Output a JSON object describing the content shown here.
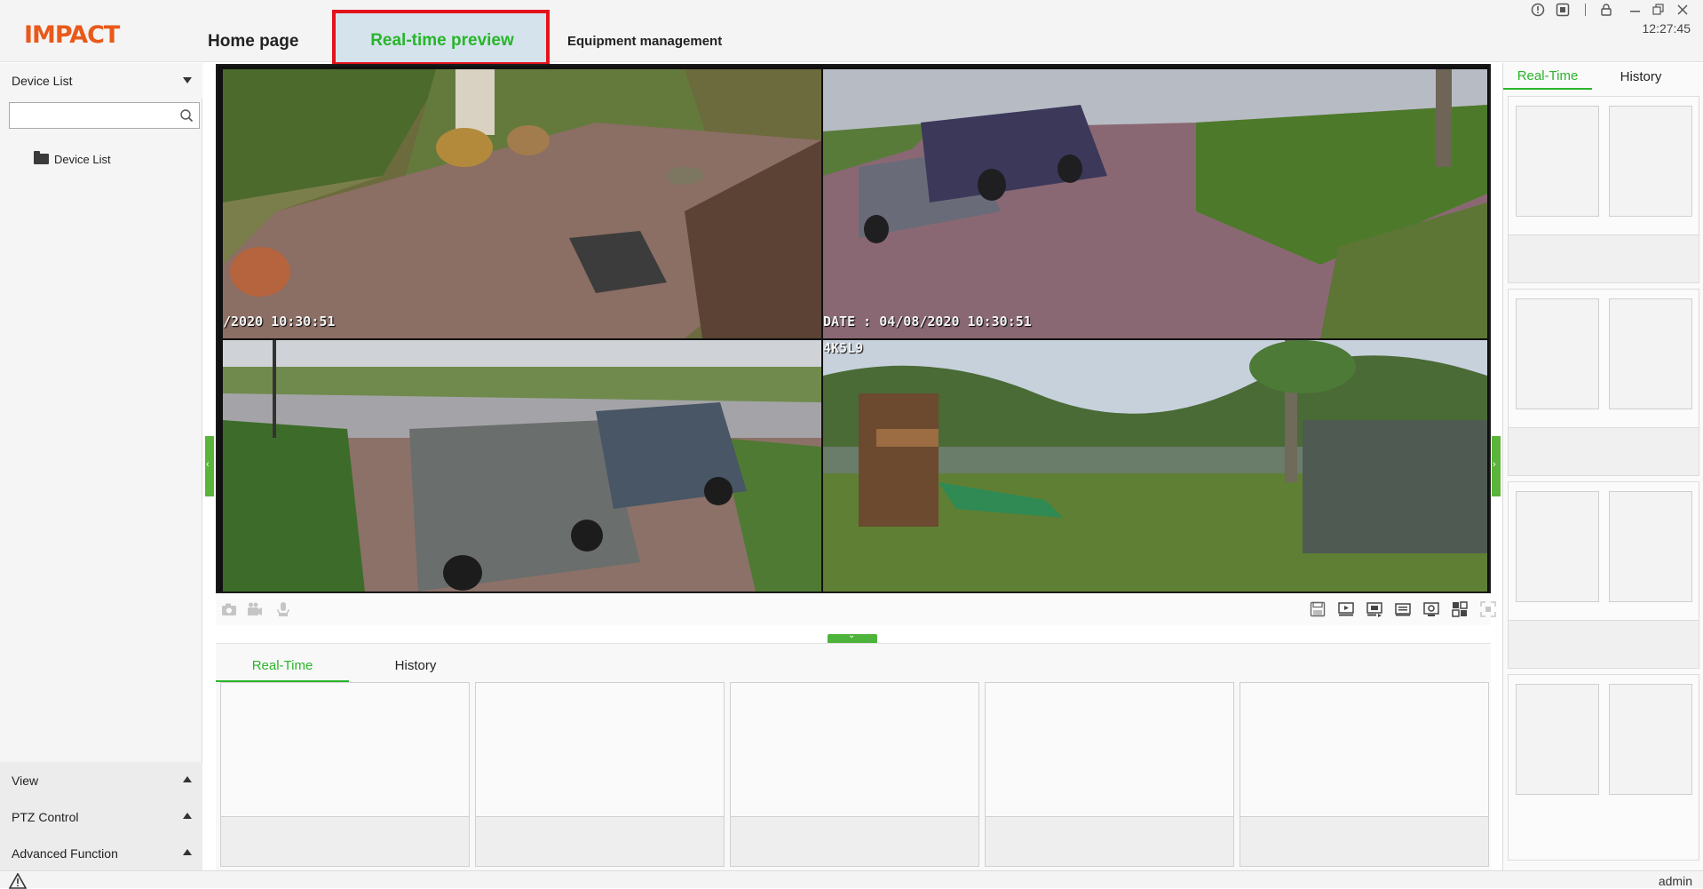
{
  "app": {
    "logo": "IMPACT",
    "clock": "12:27:45",
    "user": "admin"
  },
  "nav": {
    "home": "Home page",
    "realtime": "Real-time preview",
    "equipment": "Equipment management"
  },
  "window_icons": [
    "info-icon",
    "record-icon",
    "lock-icon",
    "minimize-icon",
    "restore-icon",
    "close-icon"
  ],
  "sidebar": {
    "device_list_header": "Device List",
    "search": {
      "value": "",
      "placeholder": ""
    },
    "tree": [
      {
        "label": "Device List",
        "icon": "folder-icon"
      }
    ],
    "sections": [
      {
        "label": "View"
      },
      {
        "label": "PTZ Control"
      },
      {
        "label": "Advanced Function"
      }
    ]
  },
  "video": {
    "timestamps": {
      "cam1": "/2020 10:30:51",
      "cam2": "DATE : 04/08/2020 10:30:51",
      "cam4": "4K5L9"
    }
  },
  "bottom_panel": {
    "tabs": [
      {
        "label": "Real-Time",
        "active": true
      },
      {
        "label": "History",
        "active": false
      }
    ],
    "tile_count": 5
  },
  "right_panel": {
    "tabs": [
      {
        "label": "Real-Time",
        "active": true
      },
      {
        "label": "History",
        "active": false
      }
    ],
    "group_count": 4
  },
  "colors": {
    "accent": "#2bb52a",
    "brand": "#e8591a",
    "highlight": "#e3131b",
    "active_tab_bg": "#d4e3ec"
  }
}
